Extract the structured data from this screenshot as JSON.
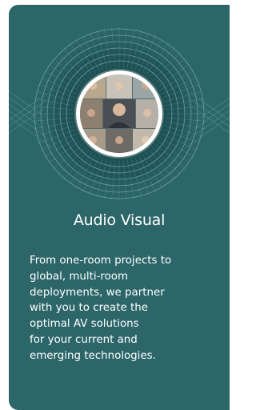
{
  "card": {
    "title": "Audio Visual",
    "body_lines": [
      "From one-room projects to",
      "global, multi-room",
      "deployments, we partner",
      "with you to create the",
      "optimal AV solutions",
      "for your current and",
      "emerging technologies."
    ],
    "image_icon": "video-conference-photo",
    "colors": {
      "card_background": "#2c6669",
      "ring_accent": "#1f5457",
      "line_art": "#7fb3b0",
      "text": "#ffffff"
    }
  }
}
